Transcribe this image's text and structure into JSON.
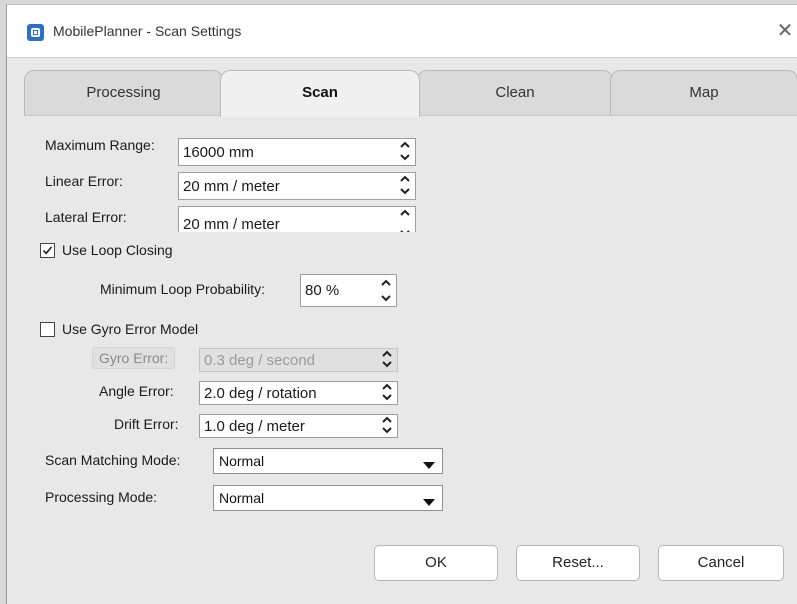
{
  "window": {
    "title": "MobilePlanner - Scan Settings",
    "app_icon": "app-icon",
    "close_icon": "close-icon"
  },
  "tabs": [
    {
      "label": "Processing",
      "active": false
    },
    {
      "label": "Scan",
      "active": true
    },
    {
      "label": "Clean",
      "active": false
    },
    {
      "label": "Map",
      "active": false
    }
  ],
  "fields": {
    "max_range": {
      "label": "Maximum Range:",
      "value": "16000 mm"
    },
    "linear_error": {
      "label": "Linear Error:",
      "value": "20 mm / meter"
    },
    "lateral_error": {
      "label": "Lateral Error:",
      "value": "20 mm / meter"
    },
    "loop_closing": {
      "label": "Use Loop Closing",
      "checked": true
    },
    "min_loop_prob": {
      "label": "Minimum Loop Probability:",
      "value": "80 %"
    },
    "gyro_model": {
      "label": "Use Gyro Error Model",
      "checked": false
    },
    "gyro_error": {
      "label": "Gyro Error:",
      "value": "0.3 deg / second",
      "disabled": true
    },
    "angle_error": {
      "label": "Angle Error:",
      "value": "2.0 deg / rotation"
    },
    "drift_error": {
      "label": "Drift Error:",
      "value": "1.0 deg / meter"
    },
    "scan_matching_mode": {
      "label": "Scan Matching Mode:",
      "value": "Normal"
    },
    "processing_mode": {
      "label": "Processing Mode:",
      "value": "Normal"
    }
  },
  "buttons": {
    "ok": "OK",
    "reset": "Reset...",
    "cancel": "Cancel"
  },
  "colors": {
    "background": "#e8e8e8",
    "titlebar": "#ffffff",
    "app_icon": "#2f6fc4"
  }
}
